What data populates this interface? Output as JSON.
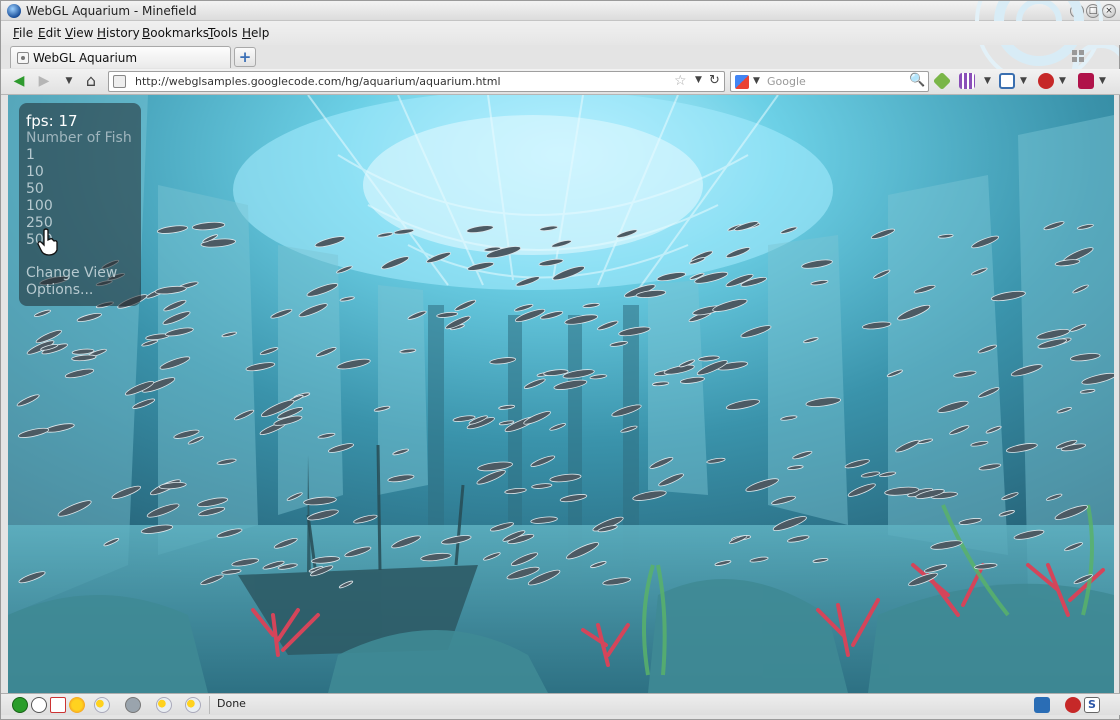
{
  "window": {
    "title": "WebGL Aquarium - Minefield"
  },
  "menubar": [
    {
      "key": "F",
      "rest": "ile"
    },
    {
      "key": "E",
      "rest": "dit"
    },
    {
      "key": "V",
      "rest": "iew"
    },
    {
      "key": "H",
      "rest": "istory"
    },
    {
      "key": "B",
      "rest": "ookmarks"
    },
    {
      "key": "T",
      "rest": "ools"
    },
    {
      "key": "H",
      "rest": "elp"
    }
  ],
  "tabs": [
    {
      "label": "WebGL Aquarium"
    }
  ],
  "newtab": {
    "glyph": "+"
  },
  "navigation": {
    "back_glyph": "◀",
    "forward_glyph": "▶",
    "history_drop": "▼",
    "home_glyph": "⌂",
    "url": "http://webglsamples.googlecode.com/hg/aquarium/aquarium.html",
    "star": "☆",
    "url_drop": "▼",
    "reload": "↻"
  },
  "search": {
    "placeholder": "Google",
    "drop": "▼",
    "go": "🔍"
  },
  "toolbar_addons": {
    "drop": "▼"
  },
  "aquarium": {
    "fps_label": "fps: 17",
    "fish_heading": "Number of Fish",
    "fish_options": [
      "1",
      "10",
      "50",
      "100",
      "250",
      "500"
    ],
    "change_view": "Change View",
    "options": "Options..."
  },
  "status": {
    "text": "Done"
  },
  "colors": {
    "water": "#3a8fa6",
    "overlay": "rgba(30,40,45,0.55)",
    "coral": "#d4455a"
  }
}
